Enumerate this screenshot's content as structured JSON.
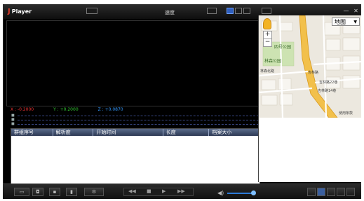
{
  "app": {
    "title": "Player"
  },
  "toolbar": {
    "speed_label": "速度"
  },
  "sensor": {
    "x_readout": "X : -0.2000",
    "y_readout": "Y : +0.2000",
    "z_readout": "Z : +0.0870"
  },
  "table": {
    "columns": [
      "群组序号",
      "解析度",
      "开始时间",
      "长度",
      "档案大小"
    ]
  },
  "map": {
    "type_label": "地图",
    "places": [
      "林森公园",
      "四号公园",
      "林森北路",
      "吉林路",
      "吉林路22巷",
      "吉林路14巷",
      "使用条款"
    ]
  },
  "colors": {
    "accent": "#2f5fbf",
    "road": "#f2c04b",
    "x": "#e33",
    "y": "#3c3",
    "z": "#39f"
  }
}
